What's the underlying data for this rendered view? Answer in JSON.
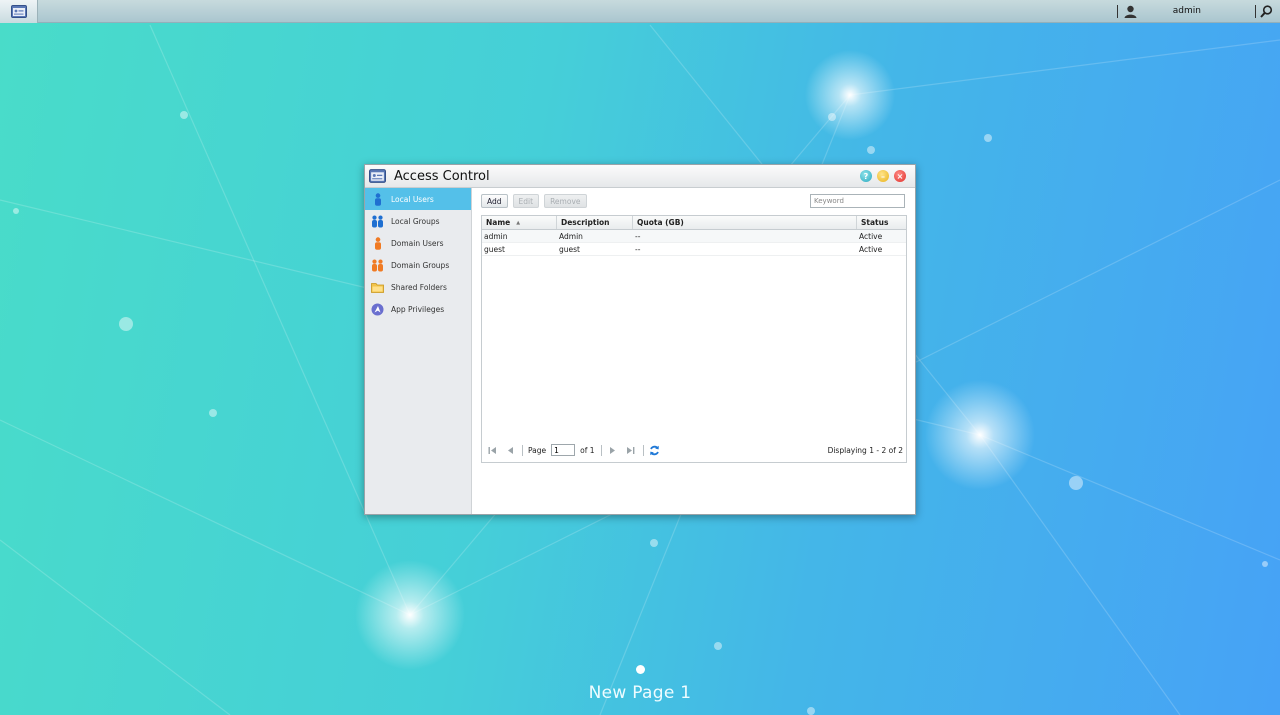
{
  "topbar": {
    "username": "admin"
  },
  "window": {
    "title": "Access Control"
  },
  "sidebar": {
    "items": [
      {
        "label": "Local Users",
        "icon": "user-icon",
        "active": true
      },
      {
        "label": "Local Groups",
        "icon": "group-icon",
        "active": false
      },
      {
        "label": "Domain Users",
        "icon": "domain-user-icon",
        "active": false
      },
      {
        "label": "Domain Groups",
        "icon": "domain-group-icon",
        "active": false
      },
      {
        "label": "Shared Folders",
        "icon": "folder-icon",
        "active": false
      },
      {
        "label": "App Privileges",
        "icon": "app-privileges-icon",
        "active": false
      }
    ]
  },
  "toolbar": {
    "add_label": "Add",
    "edit_label": "Edit",
    "remove_label": "Remove",
    "keyword_placeholder": "Keyword"
  },
  "grid": {
    "columns": [
      "Name",
      "Description",
      "Quota (GB)",
      "Status"
    ],
    "rows": [
      {
        "name": "admin",
        "description": "Admin",
        "quota": "--",
        "status": "Active"
      },
      {
        "name": "guest",
        "description": "guest",
        "quota": "--",
        "status": "Active"
      }
    ]
  },
  "pager": {
    "page_label": "Page",
    "page_value": "1",
    "of_label": "of 1",
    "display_text": "Displaying 1 - 2 of 2"
  },
  "desktop": {
    "page_label": "New Page 1"
  },
  "colors": {
    "accent": "#54c0e9",
    "close": "#e0302a",
    "minimize": "#e9b21a",
    "help": "#2aa9c0"
  }
}
